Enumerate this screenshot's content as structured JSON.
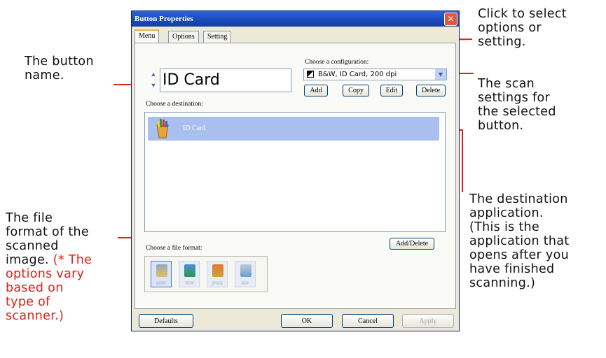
{
  "dialog": {
    "title": "Button Properties",
    "close_glyph": "✕",
    "tabs": [
      "Menu",
      "Options",
      "Setting"
    ],
    "button_name": "ID Card",
    "config_label": "Choose a configuration:",
    "config_value": "B&W, ID Card, 200 dpi",
    "config_buttons": {
      "add": "Add",
      "copy": "Copy",
      "edit": "Edit",
      "delete": "Delete"
    },
    "destination_label": "Choose a destination:",
    "destination_item": "ID Card",
    "add_delete_label": "Add/Delete",
    "format_label": "Choose a file format:",
    "formats": [
      "BMP",
      "TIFF",
      "JPEG",
      "GIF"
    ],
    "footer": {
      "defaults": "Defaults",
      "ok": "OK",
      "cancel": "Cancel",
      "apply": "Apply"
    }
  },
  "annotations": {
    "button_name": [
      "The button",
      "name."
    ],
    "tabs": [
      "Click to select",
      "options or",
      "setting."
    ],
    "scan_settings": [
      "The scan",
      "settings for",
      "the selected",
      "button."
    ],
    "destination": [
      "The destination",
      "application.",
      "(This is the",
      "application that",
      "opens after you",
      "have finished",
      "scanning.)"
    ],
    "file_format": [
      "The file",
      "format of the",
      "scanned",
      "image."
    ],
    "file_format_note": [
      "(* The",
      "options vary",
      "based on",
      "type of",
      "scanner.)"
    ]
  },
  "colors": {
    "annotation_line": "#e0201c",
    "note_text": "#e0201c",
    "title_bar": "#1a48b8",
    "selected_row": "#a8bff0"
  }
}
